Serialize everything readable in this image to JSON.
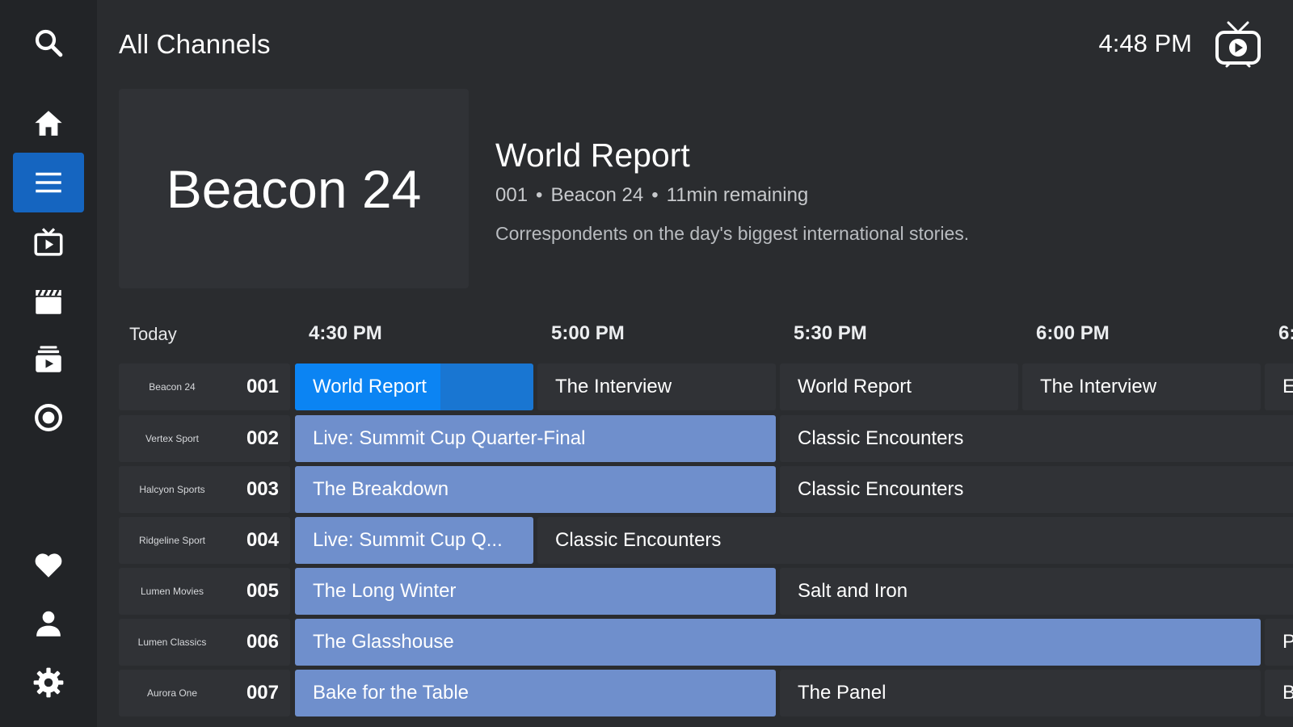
{
  "header": {
    "title": "All Channels",
    "clock": "4:48 PM"
  },
  "sidebar": {
    "items": [
      {
        "name": "search-icon",
        "active": false
      },
      {
        "name": "home-icon",
        "active": false
      },
      {
        "name": "guide-menu-icon",
        "active": true
      },
      {
        "name": "live-tv-icon",
        "active": false
      },
      {
        "name": "movies-clapper-icon",
        "active": false
      },
      {
        "name": "library-icon",
        "active": false
      },
      {
        "name": "record-icon",
        "active": false
      },
      {
        "name": "heart-icon",
        "active": false
      },
      {
        "name": "user-icon",
        "active": false
      },
      {
        "name": "settings-gear-icon",
        "active": false
      }
    ]
  },
  "preview": {
    "channel_logo_text": "Beacon 24",
    "program_title": "World Report",
    "channel_number": "001",
    "separator": "•",
    "channel_name": "Beacon 24",
    "remaining": "11min remaining",
    "description": "Correspondents on the day's biggest international stories."
  },
  "timeline": {
    "day": "Today",
    "slots": [
      "4:30 PM",
      "5:00 PM",
      "5:30 PM",
      "6:00 PM",
      "6:"
    ]
  },
  "accent_colors": {
    "active_nav": "#1565c0",
    "now_airing": "#6f8fcc",
    "selected": "#1976d2",
    "progress": "#0b84f3"
  },
  "guide": {
    "rows": [
      {
        "channel": "Beacon 24",
        "number": "001",
        "programs": [
          {
            "title": "World Report",
            "state": "selected",
            "progress": 0.61
          },
          {
            "title": "The Interview",
            "state": "future"
          },
          {
            "title": "World Report",
            "state": "future"
          },
          {
            "title": "The Interview",
            "state": "future"
          },
          {
            "title": "E",
            "state": "future"
          }
        ]
      },
      {
        "channel": "Vertex Sport",
        "number": "002",
        "programs": [
          {
            "title": "Live: Summit Cup Quarter-Final",
            "state": "now"
          },
          {
            "title": "Classic Encounters",
            "state": "future"
          }
        ]
      },
      {
        "channel": "Halcyon Sports",
        "number": "003",
        "programs": [
          {
            "title": "The Breakdown",
            "state": "now"
          },
          {
            "title": "Classic Encounters",
            "state": "future"
          }
        ]
      },
      {
        "channel": "Ridgeline Sport",
        "number": "004",
        "programs": [
          {
            "title": "Live: Summit Cup Q...",
            "state": "now"
          },
          {
            "title": "Classic Encounters",
            "state": "future"
          }
        ]
      },
      {
        "channel": "Lumen Movies",
        "number": "005",
        "programs": [
          {
            "title": "The Long Winter",
            "state": "now"
          },
          {
            "title": "Salt and Iron",
            "state": "future"
          }
        ]
      },
      {
        "channel": "Lumen Classics",
        "number": "006",
        "programs": [
          {
            "title": "The Glasshouse",
            "state": "now"
          },
          {
            "title": "P",
            "state": "future"
          }
        ]
      },
      {
        "channel": "Aurora One",
        "number": "007",
        "programs": [
          {
            "title": "Bake for the Table",
            "state": "now"
          },
          {
            "title": "The Panel",
            "state": "future"
          },
          {
            "title": "B",
            "state": "future"
          }
        ]
      }
    ]
  }
}
